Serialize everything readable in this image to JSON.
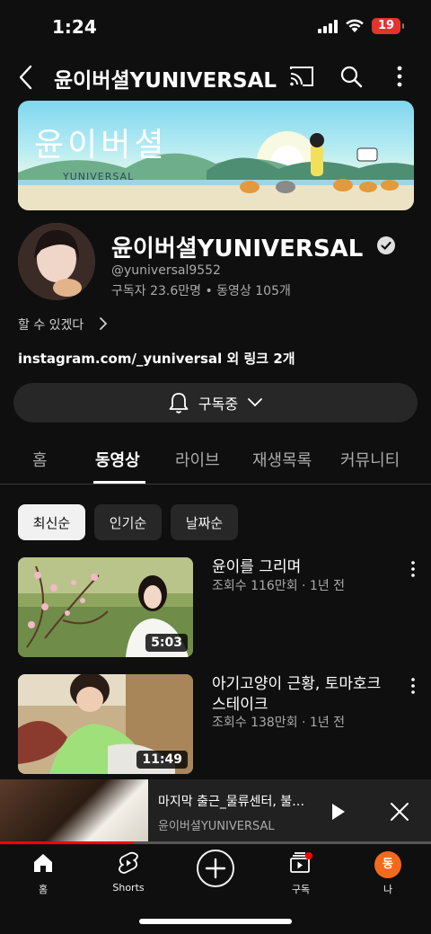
{
  "status_bar": {
    "time": "1:24",
    "battery": "19"
  },
  "header": {
    "title": "윤이버셜YUNIVERSAL"
  },
  "banner": {
    "logo_ko": "윤이버셜",
    "logo_en": "YUNIVERSAL"
  },
  "channel": {
    "name": "윤이버셜YUNIVERSAL",
    "handle": "@yuniversal9552",
    "stats": "구독자 23.6만명 • 동영상 105개",
    "description": "할 수 있겠다",
    "link": "instagram.com/_yuniversal 외 링크 2개"
  },
  "subscribe": {
    "label": "구독중"
  },
  "tabs": [
    {
      "label": "홈"
    },
    {
      "label": "동영상"
    },
    {
      "label": "라이브"
    },
    {
      "label": "재생목록"
    },
    {
      "label": "커뮤니티"
    }
  ],
  "active_tab": "동영상",
  "chips": [
    {
      "label": "최신순"
    },
    {
      "label": "인기순"
    },
    {
      "label": "날짜순"
    }
  ],
  "videos": [
    {
      "title": "윤이를 그리며",
      "meta": "조회수 116만회 · 1년 전",
      "duration": "5:03"
    },
    {
      "title": "아기고양이 근황, 토마호크 스테이크",
      "meta": "조회수 138만회 · 1년 전",
      "duration": "11:49"
    }
  ],
  "mini_player": {
    "title": "마지막 출근_물류센터, 불…",
    "channel": "윤이버셜YUNIVERSAL",
    "progress": 0.31
  },
  "nav": [
    {
      "label": "홈"
    },
    {
      "label": "Shorts"
    },
    {
      "label": "구독"
    },
    {
      "label": "나",
      "avatar_letter": "동"
    }
  ],
  "colors": {
    "accent": "#ff0000",
    "avatar_bg": "#f26a1b",
    "background": "#0f0f0f"
  }
}
